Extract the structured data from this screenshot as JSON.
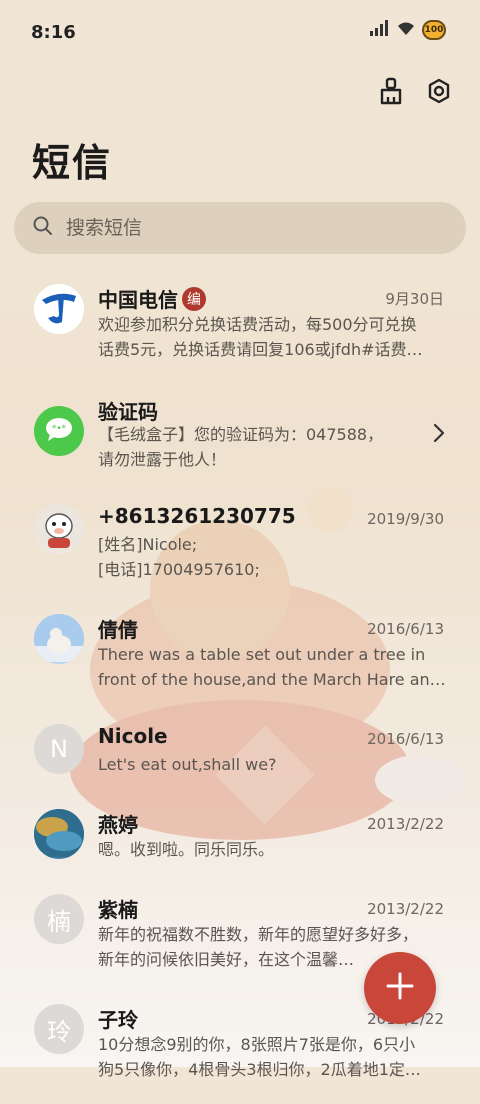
{
  "status": {
    "time": "8:16",
    "battery": "100"
  },
  "header": {
    "title": "短信"
  },
  "search": {
    "placeholder": "搜索短信"
  },
  "conversations": [
    {
      "name": "中国电信",
      "badge": "编",
      "date": "9月30日",
      "line1": "欢迎参加积分兑换话费活动，每500分可兑换",
      "line2": "话费5元，兑换话费请回复106或jfdh#话费…"
    },
    {
      "name": "验证码",
      "line1": "【毛绒盒子】您的验证码为：047588，",
      "line2": "请勿泄露于他人！"
    },
    {
      "name": "+8613261230775",
      "date": "2019/9/30",
      "line1": "[姓名]Nicole;",
      "line2": "[电话]17004957610;"
    },
    {
      "name": "倩倩",
      "date": "2016/6/13",
      "line1": "There was a table set out under a tree in",
      "line2": "front of the house,and the March Hare an…"
    },
    {
      "name": "Nicole",
      "avatar_letter": "N",
      "date": "2016/6/13",
      "line1": "Let's eat out,shall we?"
    },
    {
      "name": "燕婷",
      "date": "2013/2/22",
      "line1": "嗯。收到啦。同乐同乐。"
    },
    {
      "name": "紫楠",
      "avatar_letter": "楠",
      "date": "2013/2/22",
      "line1": "新年的祝福数不胜数，新年的愿望好多好多，",
      "line2": "新年的问候依旧美好，在这个温馨的时刻…"
    },
    {
      "name": "子玲",
      "avatar_letter": "玲",
      "date": "2013/2/22",
      "line1": "10分想念9别的你，8张照片7张是你，6只小",
      "line2": "狗5只像你，4根骨头3根归你，2瓜着地1定…"
    }
  ],
  "colors": {
    "accent": "#c8473a",
    "telecom": "#1c5fb8",
    "sms_green": "#4cc84a"
  }
}
